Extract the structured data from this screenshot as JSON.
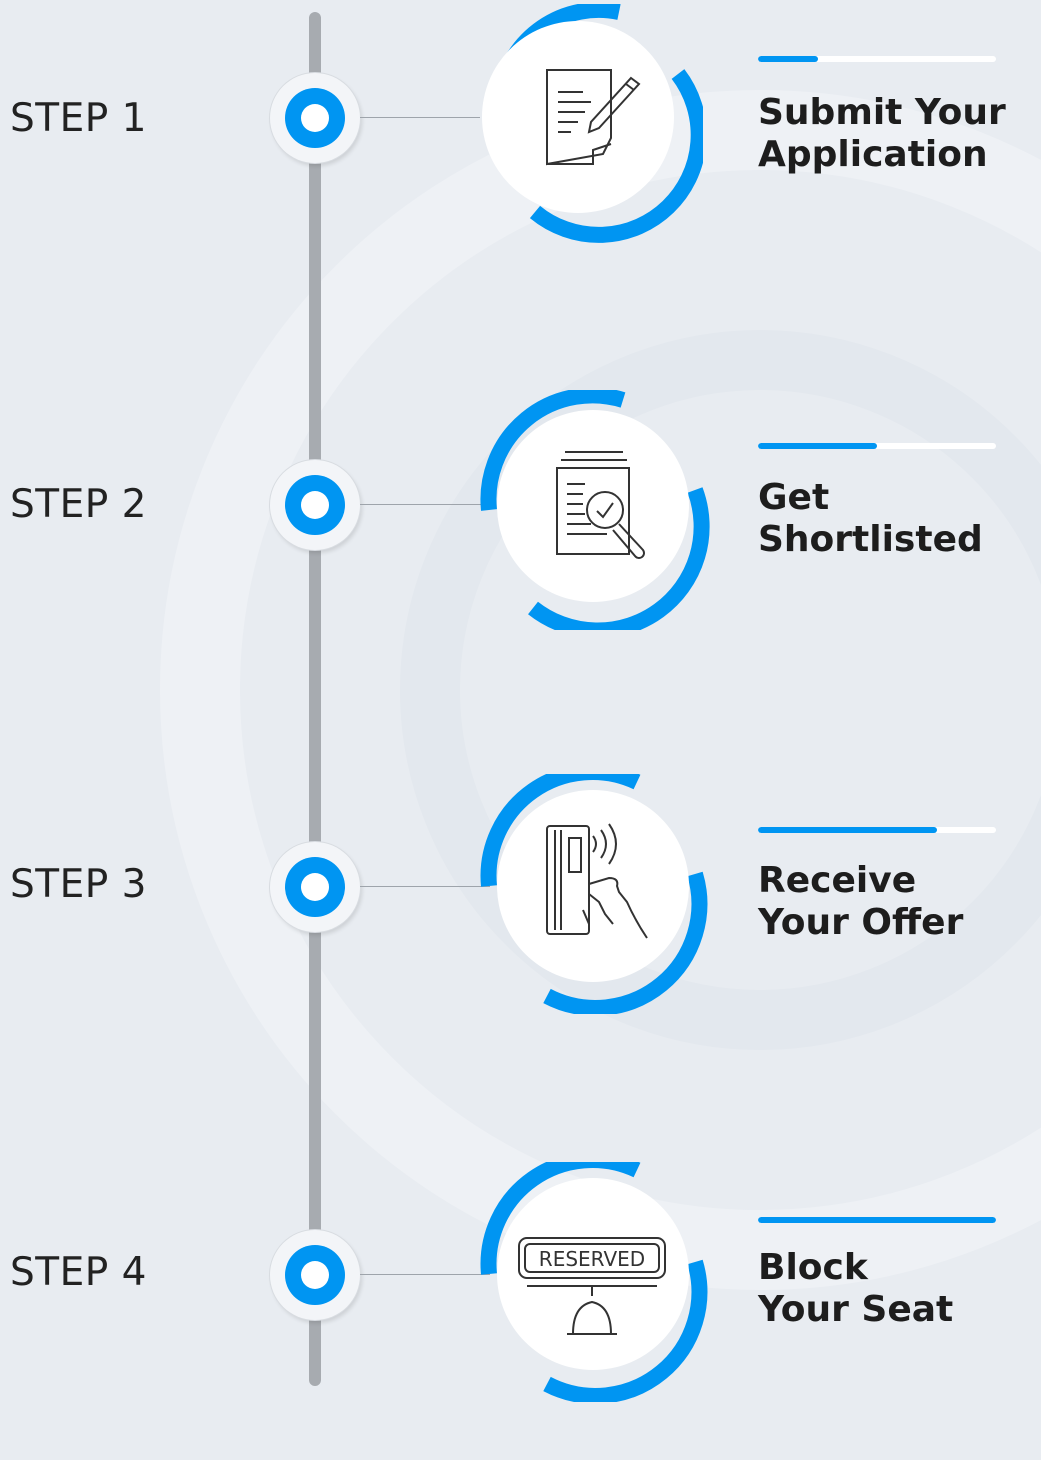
{
  "colors": {
    "accent": "#0095f2",
    "line": "#a7abb0",
    "text": "#1d1d1d",
    "background": "#e8ecf1"
  },
  "steps": [
    {
      "label": "STEP 1",
      "title_line1": "Submit Your",
      "title_line2": "Application",
      "icon": "application-form-pen-icon",
      "progress": 0.25
    },
    {
      "label": "STEP 2",
      "title_line1": "Get",
      "title_line2": "Shortlisted",
      "icon": "document-search-check-icon",
      "progress": 0.5
    },
    {
      "label": "STEP 3",
      "title_line1": "Receive",
      "title_line2": "Your Offer",
      "icon": "card-tap-hand-icon",
      "progress": 0.75
    },
    {
      "label": "STEP 4",
      "title_line1": "Block",
      "title_line2": "Your Seat",
      "icon": "reserved-sign-icon",
      "icon_text": "RESERVED",
      "progress": 1.0
    }
  ]
}
